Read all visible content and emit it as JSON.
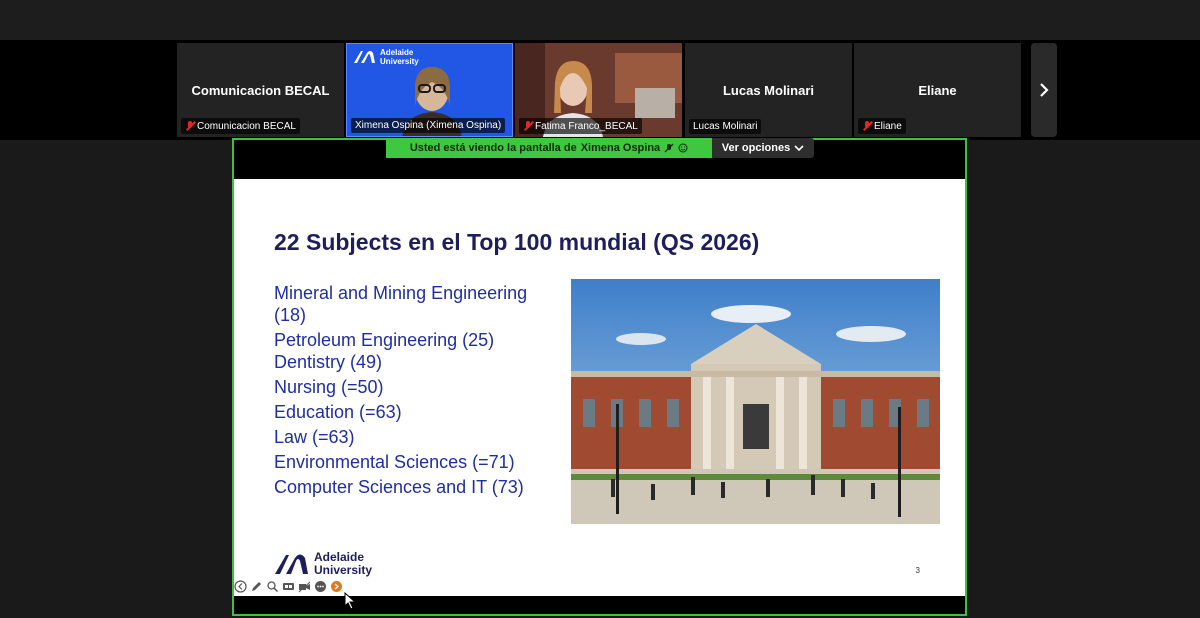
{
  "participants": [
    {
      "name": "Comunicacion BECAL",
      "label": "Comunicacion BECAL",
      "muted": true
    },
    {
      "name": "",
      "label": "Ximena Ospina (Ximena Ospina)",
      "muted": false
    },
    {
      "name": "",
      "label": "Fatima Franco_BECAL",
      "muted": true
    },
    {
      "name": "Lucas Molinari",
      "label": "Lucas Molinari",
      "muted": false
    },
    {
      "name": "Eliane",
      "label": "Eliane",
      "muted": true
    }
  ],
  "tile_logo": {
    "line1": "Adelaide",
    "line2": "University"
  },
  "share_banner": {
    "text": "Usted está viendo la pantalla de",
    "presenter": "Ximena Ospina",
    "view_options": "Ver opciones"
  },
  "slide": {
    "title": "22 Subjects en el Top 100 mundial (QS 2026)",
    "subjects": [
      "Mineral and Mining Engineering (18)",
      "Petroleum Engineering (25)",
      "Dentistry (49)",
      "Nursing (=50)",
      "Education (=63)",
      "Law (=63)",
      "Environmental Sciences (=71)",
      "Computer Sciences and IT (73)"
    ],
    "logo": {
      "line1": "Adelaide",
      "line2": "University"
    },
    "page_number": "3"
  },
  "icons": {
    "next": "chevron-right-icon",
    "mic_muted": "mic-muted-icon",
    "chevron_down": "chevron-down-icon",
    "controls": [
      "back-icon",
      "pen-icon",
      "zoom-icon",
      "captions-icon",
      "video-icon",
      "more-icon",
      "pointer-icon"
    ]
  },
  "colors": {
    "share_border": "#3ec13e",
    "banner_bg": "#3fc73f",
    "slide_title": "#1e1e5c",
    "subject_text": "#1f2ea0",
    "tile_active": "#2257e6"
  }
}
